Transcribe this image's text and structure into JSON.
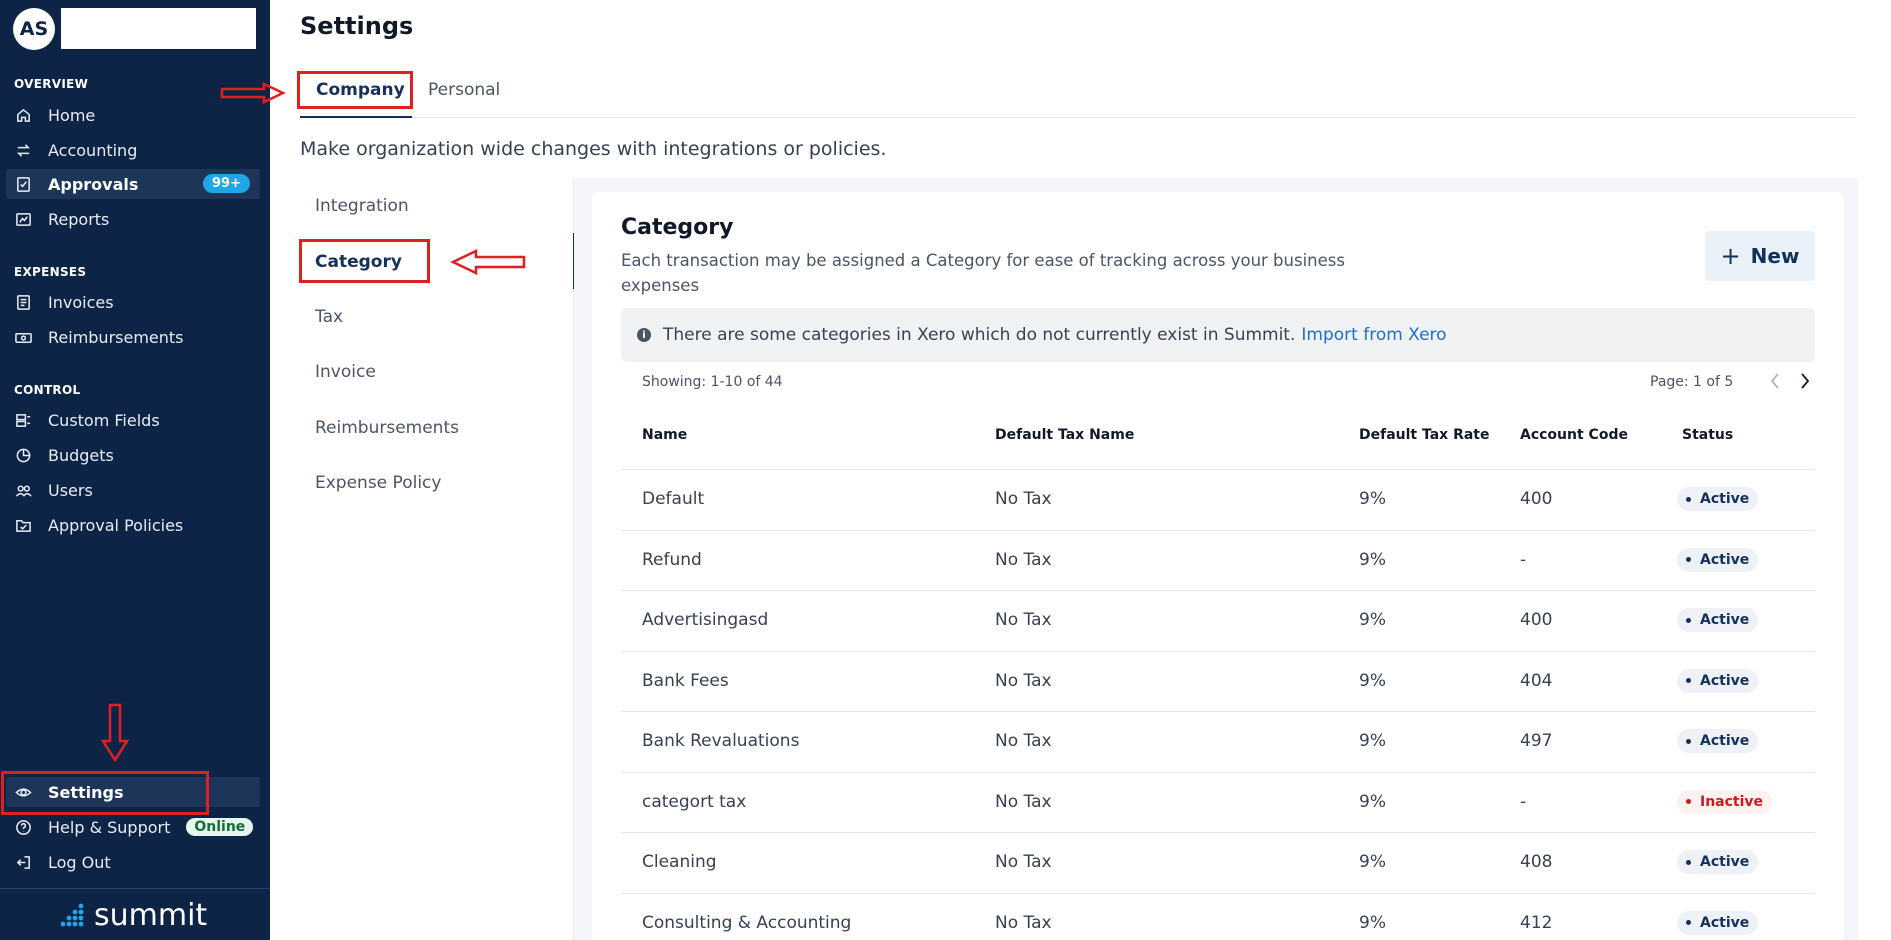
{
  "sidebar": {
    "avatar_initials": "AS",
    "sections": {
      "overview": "OVERVIEW",
      "expenses": "EXPENSES",
      "control": "CONTROL"
    },
    "items": {
      "home": "Home",
      "accounting": "Accounting",
      "approvals": "Approvals",
      "approvals_badge": "99+",
      "reports": "Reports",
      "invoices": "Invoices",
      "reimbursements": "Reimbursements",
      "custom_fields": "Custom Fields",
      "budgets": "Budgets",
      "users": "Users",
      "approval_policies": "Approval Policies",
      "settings": "Settings",
      "help": "Help & Support",
      "help_badge": "Online",
      "logout": "Log Out"
    },
    "brand": "summit"
  },
  "header": {
    "title": "Settings",
    "tabs": [
      "Company",
      "Personal"
    ],
    "subtitle": "Make organization wide changes with integrations or policies."
  },
  "subnav": [
    "Integration",
    "Category",
    "Tax",
    "Invoice",
    "Reimbursements",
    "Expense Policy"
  ],
  "category": {
    "title": "Category",
    "description": "Each transaction may be assigned a Category for ease of tracking across your business expenses",
    "new_button": "New",
    "info_text": "There are some categories in Xero which do not currently exist in Summit.",
    "info_link": "Import from Xero",
    "showing": "Showing: 1-10 of 44",
    "page": "Page: 1 of 5",
    "columns": [
      "Name",
      "Default Tax Name",
      "Default Tax Rate",
      "Account Code",
      "Status"
    ],
    "rows": [
      {
        "name": "Default",
        "tax_name": "No Tax",
        "tax_rate": "9%",
        "account_code": "400",
        "status": "Active"
      },
      {
        "name": "Refund",
        "tax_name": "No Tax",
        "tax_rate": "9%",
        "account_code": "-",
        "status": "Active"
      },
      {
        "name": "Advertisingasd",
        "tax_name": "No Tax",
        "tax_rate": "9%",
        "account_code": "400",
        "status": "Active"
      },
      {
        "name": "Bank Fees",
        "tax_name": "No Tax",
        "tax_rate": "9%",
        "account_code": "404",
        "status": "Active"
      },
      {
        "name": "Bank Revaluations",
        "tax_name": "No Tax",
        "tax_rate": "9%",
        "account_code": "497",
        "status": "Active"
      },
      {
        "name": "categort tax",
        "tax_name": "No Tax",
        "tax_rate": "9%",
        "account_code": "-",
        "status": "Inactive"
      },
      {
        "name": "Cleaning",
        "tax_name": "No Tax",
        "tax_rate": "9%",
        "account_code": "408",
        "status": "Active"
      },
      {
        "name": "Consulting & Accounting",
        "tax_name": "No Tax",
        "tax_rate": "9%",
        "account_code": "412",
        "status": "Active"
      }
    ]
  },
  "colors": {
    "sidebar_bg": "#0d2446",
    "accent": "#15305a",
    "badge_blue": "#1ea7e4",
    "annotation_red": "#e02020",
    "inactive_red": "#d11a1a"
  }
}
